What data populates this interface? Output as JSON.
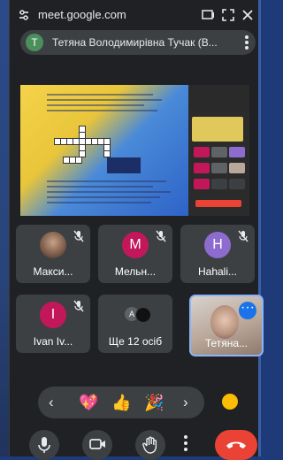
{
  "browser": {
    "url": "meet.google.com"
  },
  "meeting": {
    "avatar_letter": "T",
    "title": "Тетяна Володимирівна Тучак (В..."
  },
  "participants": [
    {
      "name": "Макси...",
      "avatar": "photo",
      "muted": true
    },
    {
      "name": "Мельн...",
      "avatar_letter": "M",
      "avatar_color": "#c2185b",
      "muted": true
    },
    {
      "name": "Hahali...",
      "avatar_letter": "H",
      "avatar_color": "#8e6ccf",
      "muted": true
    },
    {
      "name": "Ivan Iv...",
      "avatar_letter": "I",
      "avatar_color": "#c2185b",
      "muted": true
    },
    {
      "name": "Ще 12 осіб",
      "avatar": "group"
    },
    {
      "name": "Тетяна...",
      "avatar": "self-video"
    }
  ],
  "reactions": [
    {
      "icon": "sparkling-heart"
    },
    {
      "icon": "thumbs-up"
    },
    {
      "icon": "party-popper"
    }
  ],
  "controls": {
    "mic": "mic-icon",
    "camera": "camera-icon",
    "raise_hand": "hand-icon",
    "more": "more-icon",
    "end_call": "end-call-icon"
  },
  "colors": {
    "end_call": "#ea4335",
    "accent": "#8ab4f8",
    "panel": "#3c4043"
  }
}
